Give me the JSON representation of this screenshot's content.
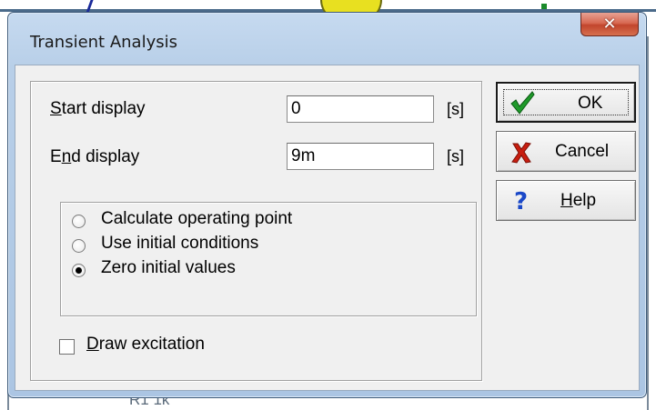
{
  "window": {
    "title": "Transient Analysis",
    "close_glyph": "✕"
  },
  "fields": {
    "start_label_underlined": "S",
    "start_label_rest": "tart display",
    "start_value": "0",
    "start_unit": "[s]",
    "end_label_first": "E",
    "end_label_underlined": "n",
    "end_label_rest": "d display",
    "end_value": "9m",
    "end_unit": "[s]"
  },
  "options": {
    "radios": [
      {
        "label": "Calculate operating point",
        "checked": false
      },
      {
        "label": "Use initial conditions",
        "checked": false
      },
      {
        "label": "Zero initial values",
        "checked": true
      }
    ],
    "draw_excitation_underlined": "D",
    "draw_excitation_rest": "raw excitation",
    "draw_excitation_checked": false
  },
  "buttons": {
    "ok_label": "OK",
    "cancel_label": "Cancel",
    "help_underlined": "H",
    "help_rest": "elp"
  },
  "icons": {
    "ok": "checkmark-icon",
    "cancel": "red-x-icon",
    "help": "question-mark-icon",
    "close": "close-icon"
  },
  "colors": {
    "ok_check": "#1f9a2a",
    "cancel_x": "#c81e10",
    "help_q": "#1a48c8",
    "close_button": "#c9462e"
  },
  "background": {
    "partial_label": "R1  1k"
  }
}
